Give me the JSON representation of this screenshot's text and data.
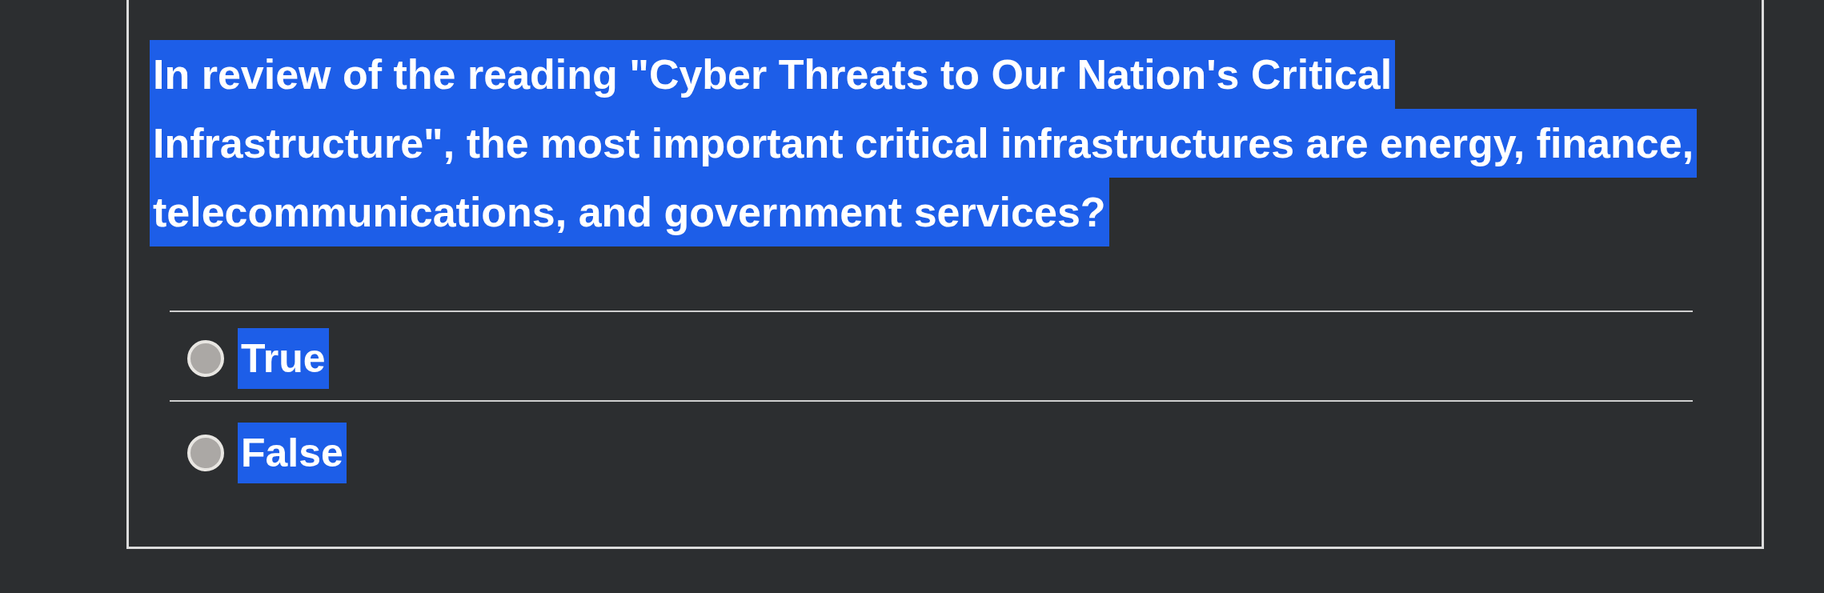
{
  "question": {
    "text": "In review of the reading \"Cyber Threats to Our Nation's Critical Infrastructure\", the most important critical infrastructures are energy, finance, telecommunications, and government services?",
    "highlighted": true
  },
  "options": [
    {
      "label": "True",
      "selected": false,
      "highlighted": true
    },
    {
      "label": "False",
      "selected": false,
      "highlighted": true
    }
  ]
}
